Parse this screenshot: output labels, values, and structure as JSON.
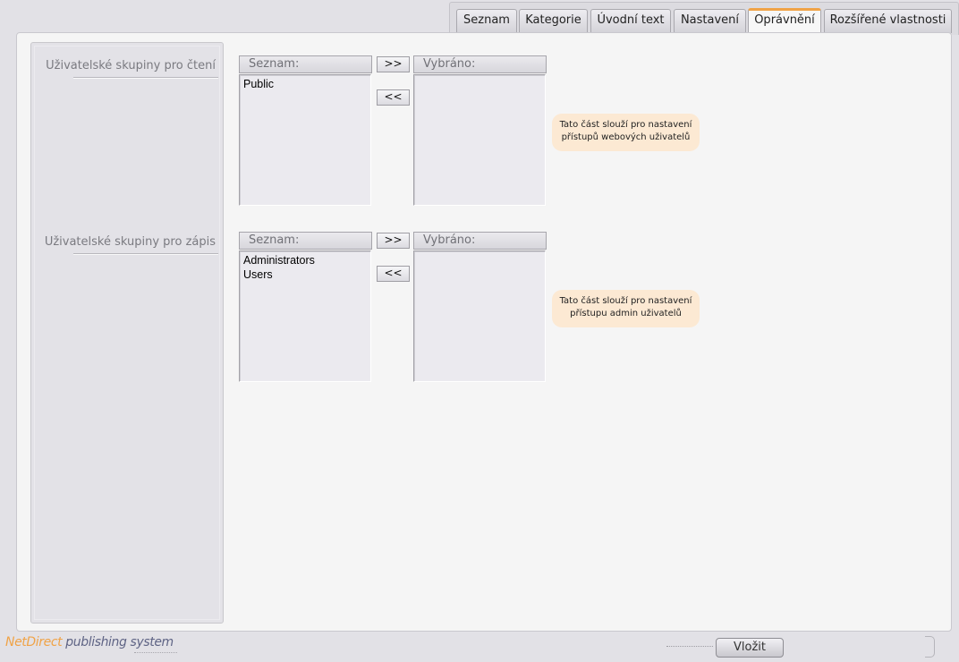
{
  "tabs": [
    {
      "label": "Seznam",
      "active": false
    },
    {
      "label": "Kategorie",
      "active": false
    },
    {
      "label": "Úvodní text",
      "active": false
    },
    {
      "label": "Nastavení",
      "active": false
    },
    {
      "label": "Oprávnění",
      "active": true
    },
    {
      "label": "Rozšířené vlastnosti",
      "active": false
    }
  ],
  "read_group": {
    "label": "Uživatelské skupiny pro čtení",
    "available_header": "Seznam:",
    "selected_header": "Vybráno:",
    "available_items": [
      "Public"
    ],
    "selected_items": [],
    "add_button": ">>",
    "remove_button": "<<",
    "hint_line1": "Tato část slouží pro nastavení",
    "hint_line2": "přístupů webových uživatelů"
  },
  "write_group": {
    "label": "Uživatelské skupiny pro zápis",
    "available_header": "Seznam:",
    "selected_header": "Vybráno:",
    "available_items": [
      "Administrators",
      "Users"
    ],
    "selected_items": [],
    "add_button": ">>",
    "remove_button": "<<",
    "hint_line1": "Tato část slouží pro nastavení",
    "hint_line2": "přístupu admin uživatelů"
  },
  "footer": {
    "brand": "NetDirect",
    "tagline": "publishing system",
    "insert_button": "Vložit"
  },
  "colors": {
    "accent": "#f0a347",
    "hint_background": "#fce9d3",
    "brand_secondary": "#5f6485"
  }
}
